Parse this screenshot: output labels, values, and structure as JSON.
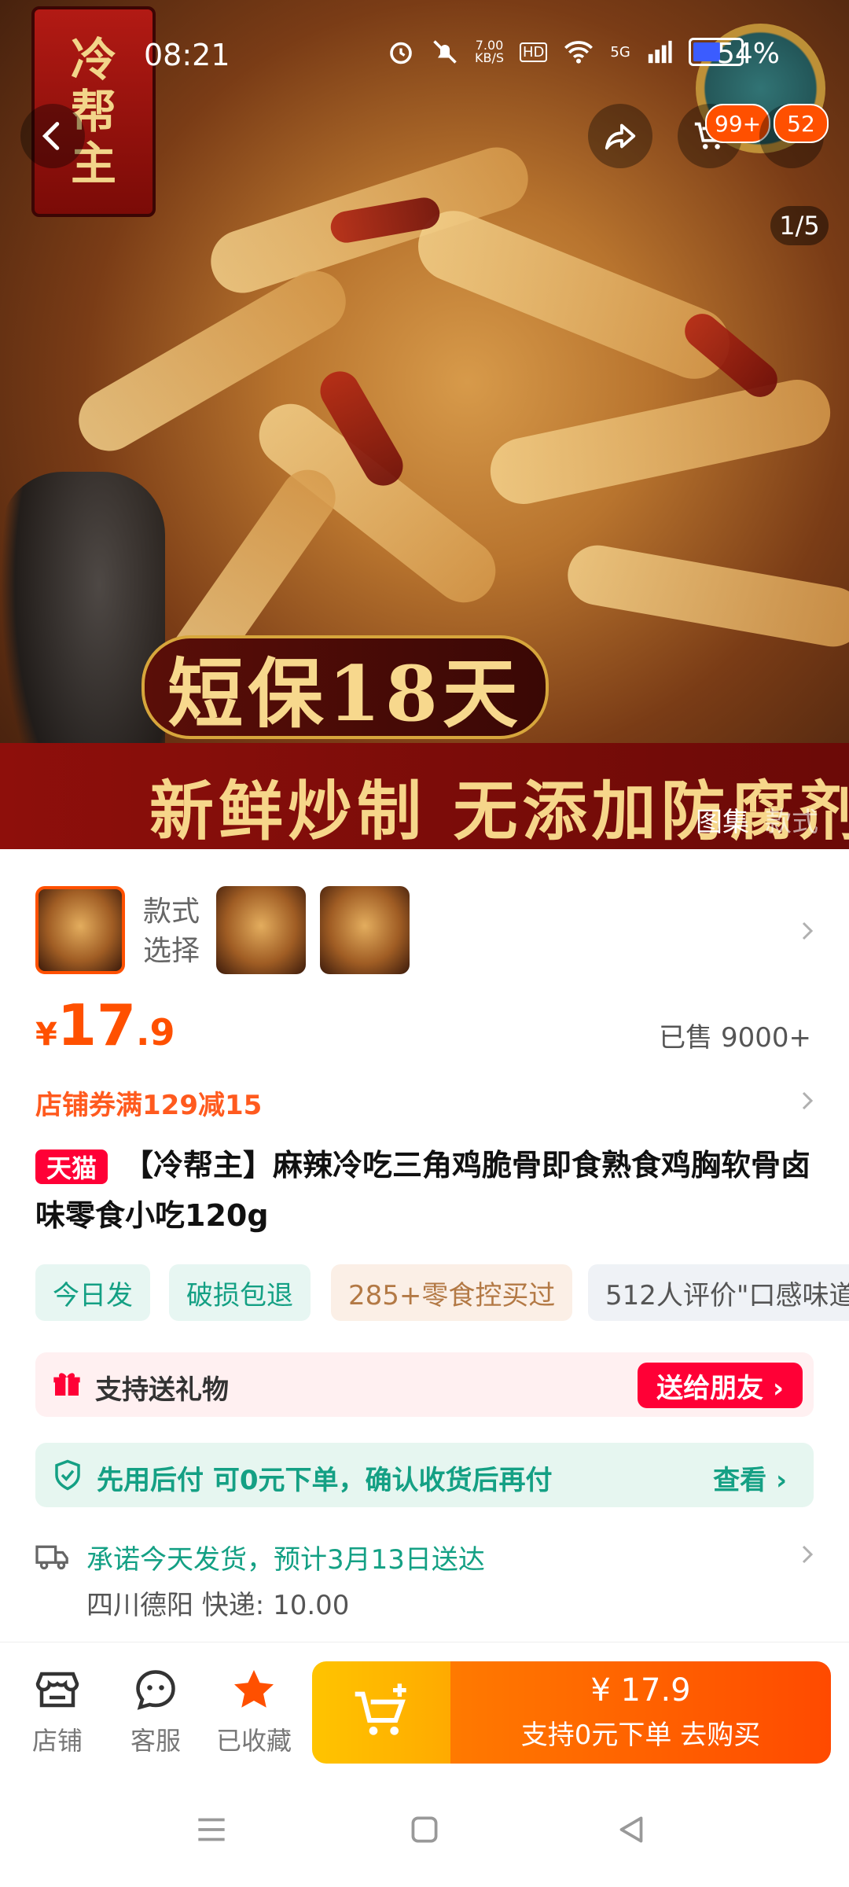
{
  "status_bar": {
    "time": "08:21",
    "net_speed": "7.00\nKB/S",
    "hd": "HD",
    "signal": "5G",
    "battery": "54%"
  },
  "hero": {
    "logo_text": "冷\n帮\n主",
    "banner_top": "短保18天",
    "banner_bottom": "新鲜炒制 无添加防腐剂",
    "counter": "1/5",
    "gallery_tabs": [
      "图集",
      "款式"
    ],
    "cart_badge": "99+",
    "msg_badge": "52"
  },
  "style": {
    "label": "款式\n选择"
  },
  "price": {
    "currency": "¥",
    "integer": "17",
    "decimal": ".9",
    "sold": "已售 9000+"
  },
  "coupon": "店铺券满129减15",
  "product": {
    "platform_badge": "天猫",
    "title": "【冷帮主】麻辣冷吃三角鸡脆骨即食熟食鸡胸软骨卤味零食小吃120g"
  },
  "tags": [
    {
      "text": "今日发"
    },
    {
      "text": "破损包退"
    },
    {
      "text": "285+零食控买过"
    },
    {
      "text": "512人评价\"口感味道"
    }
  ],
  "gift": {
    "text": "支持送礼物",
    "button": "送给朋友 ›"
  },
  "paylater": {
    "text": "先用后付 可0元下单，确认收货后再付",
    "view": "查看 ›"
  },
  "delivery": {
    "main": "承诺今天发货，预计3月13日送达",
    "sub": "四川德阳  快递: 10.00"
  },
  "bottom_bar": {
    "shop": "店铺",
    "service": "客服",
    "fav": "已收藏",
    "buy_price": "¥ 17.9",
    "buy_sub": "支持0元下单 去购买"
  },
  "colors": {
    "accent": "#ff5000",
    "tmall": "#ff0036",
    "green": "#14a084",
    "cta_yellow": "#ffc400"
  }
}
